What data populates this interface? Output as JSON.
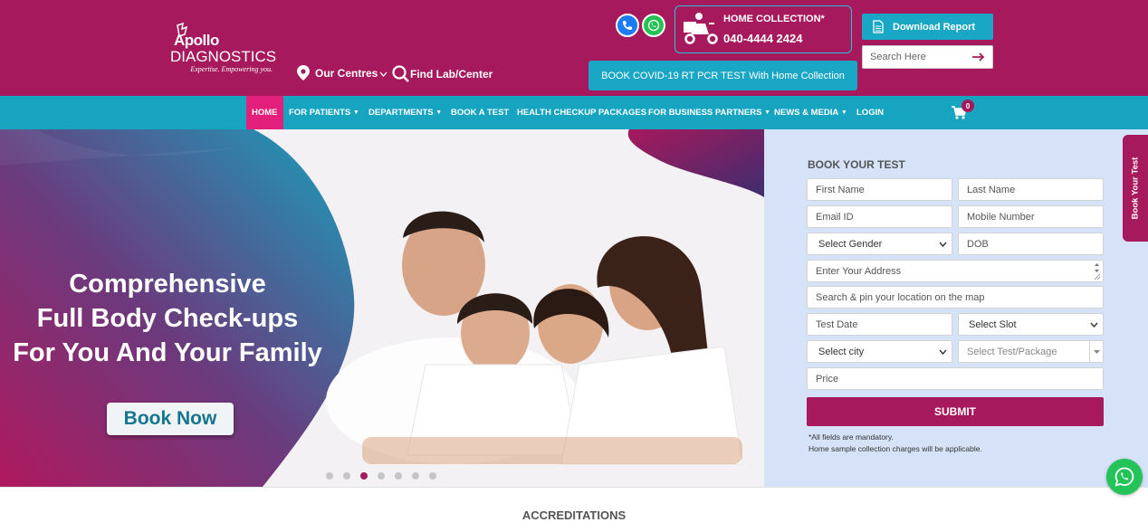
{
  "header": {
    "logo": {
      "line1": "Apollo",
      "line2": "DIAGNOSTICS",
      "tagline": "Expertise. Empowering you."
    },
    "our_centres": "Our Centres",
    "find_lab": "Find Lab/Center",
    "home_collection_label": "HOME COLLECTION*",
    "home_collection_phone": "040-4444 2424",
    "covid_button": "BOOK COVID-19 RT PCR TEST With Home Collection",
    "download_report": "Download Report",
    "search_placeholder": "Search Here"
  },
  "nav": {
    "items": [
      {
        "label": "HOME",
        "dropdown": false,
        "active": true
      },
      {
        "label": "FOR PATIENTS",
        "dropdown": true
      },
      {
        "label": "DEPARTMENTS",
        "dropdown": true
      },
      {
        "label": "BOOK A TEST",
        "dropdown": false
      },
      {
        "label": "HEALTH CHECKUP PACKAGES",
        "dropdown": false
      },
      {
        "label": "FOR BUSINESS PARTNERS",
        "dropdown": true
      },
      {
        "label": "NEWS & MEDIA",
        "dropdown": true
      },
      {
        "label": "LOGIN",
        "dropdown": false
      }
    ],
    "cart_count": "0"
  },
  "hero": {
    "line1": "Comprehensive",
    "line2": "Full Body Check-ups",
    "line3": "For You And Your Family",
    "cta": "Book Now",
    "slides": 7,
    "active_slide": 3
  },
  "form": {
    "title": "BOOK YOUR TEST",
    "first_name": "First Name",
    "last_name": "Last Name",
    "email": "Email ID",
    "mobile": "Mobile Number",
    "gender": "Select Gender",
    "dob": "DOB",
    "address": "Enter Your Address",
    "location": "Search & pin your location on the map",
    "test_date": "Test Date",
    "slot": "Select Slot",
    "city": "Select city",
    "package": "Select Test/Package",
    "price": "Price",
    "submit": "SUBMIT",
    "note1": "*All fields are mandatory.",
    "note2": "Home sample collection charges will be applicable."
  },
  "side_tab": "Book Your Test",
  "accreditations": "ACCREDITATIONS",
  "colors": {
    "brand": "#a6195c",
    "accent": "#16a4c1",
    "active_nav": "#e21f7b"
  }
}
